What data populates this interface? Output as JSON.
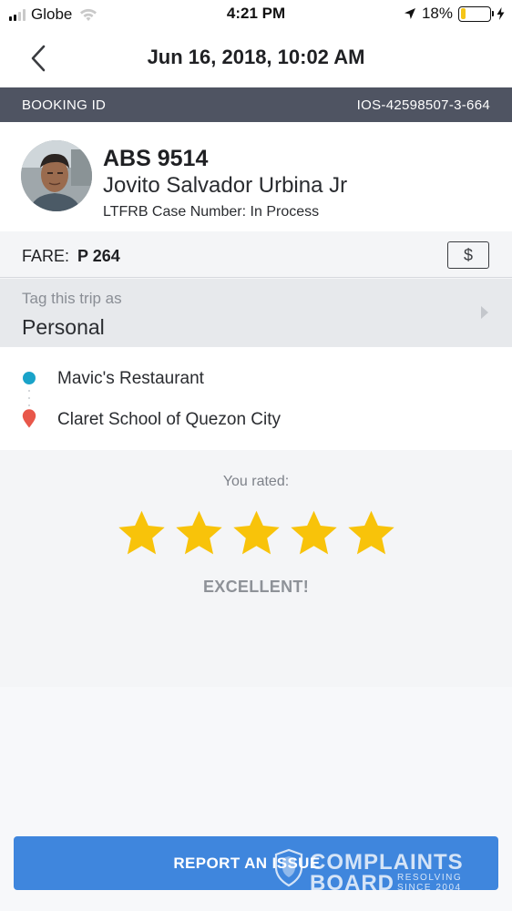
{
  "status_bar": {
    "carrier": "Globe",
    "time": "4:21 PM",
    "battery_percent": "18%",
    "battery_level": 0.18,
    "signal_bars": 2,
    "icons": [
      "signal-icon",
      "wifi-icon",
      "location-arrow-icon",
      "battery-icon",
      "charging-bolt-icon"
    ]
  },
  "header": {
    "title": "Jun 16, 2018, 10:02 AM",
    "back_icon": "chevron-left-icon"
  },
  "booking": {
    "label": "BOOKING ID",
    "id": "IOS-42598507-3-664"
  },
  "driver": {
    "plate": "ABS 9514",
    "name": "Jovito Salvador Urbina Jr",
    "case_number": "LTFRB Case Number: In Process",
    "avatar_icon": "driver-photo"
  },
  "fare": {
    "label": "FARE:",
    "value": "P 264",
    "payment_icon_glyph": "$"
  },
  "tag": {
    "label": "Tag this trip as",
    "value": "Personal"
  },
  "route": {
    "pickup": "Mavic's Restaurant",
    "dropoff": "Claret School of Quezon City",
    "pickup_color": "#1aa3c9",
    "dropoff_color": "#e8574a"
  },
  "rating": {
    "label": "You rated:",
    "stars": 5,
    "max_stars": 5,
    "text": "EXCELLENT!",
    "star_color": "#f8c30a"
  },
  "actions": {
    "report_label": "REPORT AN ISSUE",
    "button_color": "#3f86dd"
  },
  "watermark": {
    "line1": "COMPLAINTS",
    "line2": "BOARD",
    "tagline1": "RESOLVING",
    "tagline2": "SINCE 2004"
  }
}
